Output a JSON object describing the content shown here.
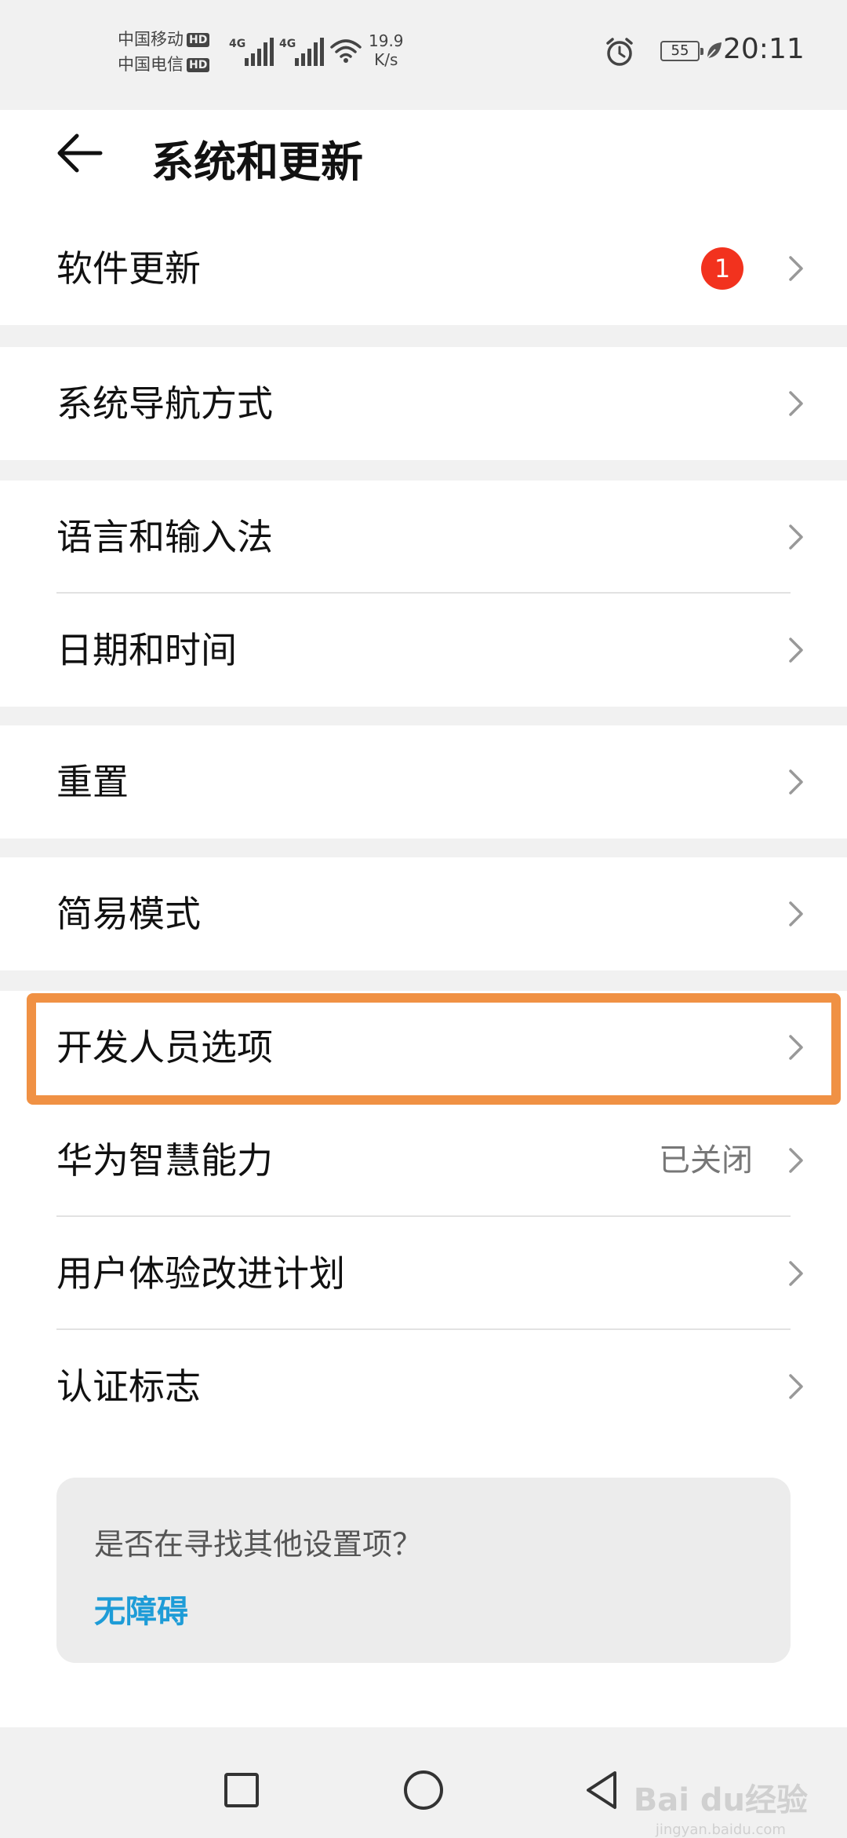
{
  "status_bar": {
    "carrier_1": "中国移动",
    "carrier_2": "中国电信",
    "hd_label": "HD",
    "network_type": "4G",
    "net_speed_value": "19.9",
    "net_speed_unit": "K/s",
    "battery_level": "55",
    "time": "20:11"
  },
  "header": {
    "title": "系统和更新",
    "back_icon": "arrow-left-icon"
  },
  "groups": [
    {
      "items": [
        {
          "label": "软件更新",
          "badge": "1"
        }
      ]
    },
    {
      "items": [
        {
          "label": "系统导航方式"
        }
      ]
    },
    {
      "items": [
        {
          "label": "语言和输入法"
        },
        {
          "label": "日期和时间"
        }
      ]
    },
    {
      "items": [
        {
          "label": "重置"
        }
      ]
    },
    {
      "items": [
        {
          "label": "简易模式"
        }
      ]
    },
    {
      "items": [
        {
          "label": "开发人员选项"
        },
        {
          "label": "华为智慧能力",
          "value": "已关闭"
        },
        {
          "label": "用户体验改进计划"
        },
        {
          "label": "认证标志"
        }
      ]
    }
  ],
  "suggestion": {
    "question": "是否在寻找其他设置项？",
    "link": "无障碍"
  },
  "watermark": {
    "brand": "Bai du经验",
    "site": "jingyan.baidu.com"
  },
  "colors": {
    "highlight": "#f09144",
    "badge": "#f2321e",
    "link": "#1e9cd7"
  }
}
